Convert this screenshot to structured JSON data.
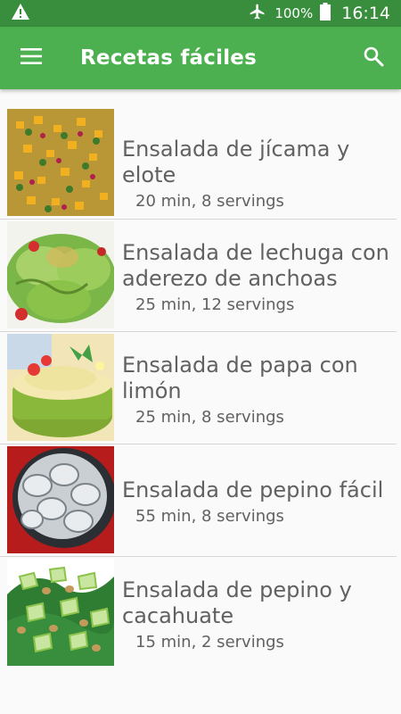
{
  "status_bar": {
    "battery": "100%",
    "time": "16:14",
    "icons": [
      "warning-icon",
      "airplane-mode-icon",
      "battery-full-icon"
    ]
  },
  "app_bar": {
    "title": "Recetas fáciles",
    "menu_icon": "hamburger-menu-icon",
    "search_icon": "search-icon",
    "color": "#4caf50",
    "status_color": "#388e3c"
  },
  "recipes": [
    {
      "name": "Ensalada de jícama y elote",
      "meta": "20 min, 8 servings",
      "image": "mango-jicama-salad-thumbnail"
    },
    {
      "name": "Ensalada de lechuga con aderezo de anchoas",
      "meta": "25 min, 12 servings",
      "image": "lettuce-salad-thumbnail"
    },
    {
      "name": "Ensalada de papa con limón",
      "meta": "25 min, 8 servings",
      "image": "potato-salad-thumbnail"
    },
    {
      "name": "Ensalada de pepino fácil",
      "meta": "55 min, 8 servings",
      "image": "creamy-cucumber-salad-thumbnail"
    },
    {
      "name": "Ensalada de pepino y cacahuate",
      "meta": "15 min, 2 servings",
      "image": "cucumber-peanut-salad-thumbnail"
    }
  ]
}
